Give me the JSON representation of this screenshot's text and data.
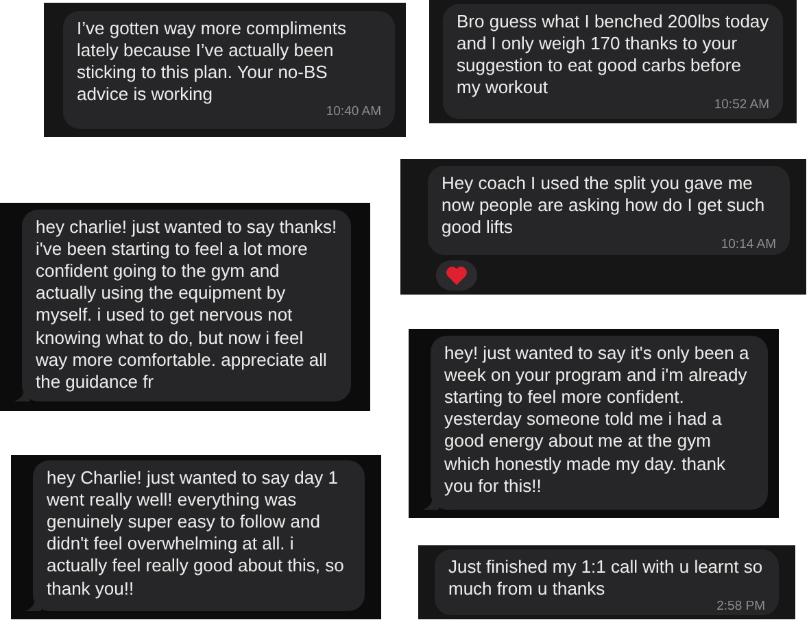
{
  "messages": [
    {
      "kind": "whatsapp",
      "text": "I’ve gotten way more compliments lately because I’ve actually been sticking to this plan. Your no-BS advice is working",
      "time": "10:40 AM",
      "reacted": false
    },
    {
      "kind": "whatsapp",
      "text": "Bro guess what I benched 200lbs today and I only weigh 170 thanks to your suggestion to eat good carbs before my workout",
      "time": "10:52 AM",
      "reacted": false
    },
    {
      "kind": "imessage",
      "text": "hey charlie! just wanted to say thanks! i've been starting to feel a lot more confident going to the gym and actually using the equipment by myself. i used to get nervous not knowing what to do, but now i feel way more comfortable. appreciate all the guidance fr",
      "reacted": false
    },
    {
      "kind": "whatsapp",
      "text": "Hey coach I used the split you gave me now people are asking how do I get such good lifts",
      "time": "10:14 AM",
      "reacted": true
    },
    {
      "kind": "imessage",
      "text": "hey! just wanted to say it's only been a week on your program and i'm already starting to feel more confident. yesterday someone told me i had a good energy about me at the gym which honestly made my day. thank you for this!!",
      "reacted": false
    },
    {
      "kind": "imessage",
      "text": "hey Charlie! just wanted to say day 1 went really well! everything was genuinely super easy to follow and didn't feel overwhelming at all. i actually feel really good about this, so thank you!!",
      "reacted": false
    },
    {
      "kind": "whatsapp",
      "text": "Just finished my 1:1 call with u learnt so much from u thanks",
      "time": "2:58 PM",
      "reacted": false
    }
  ]
}
